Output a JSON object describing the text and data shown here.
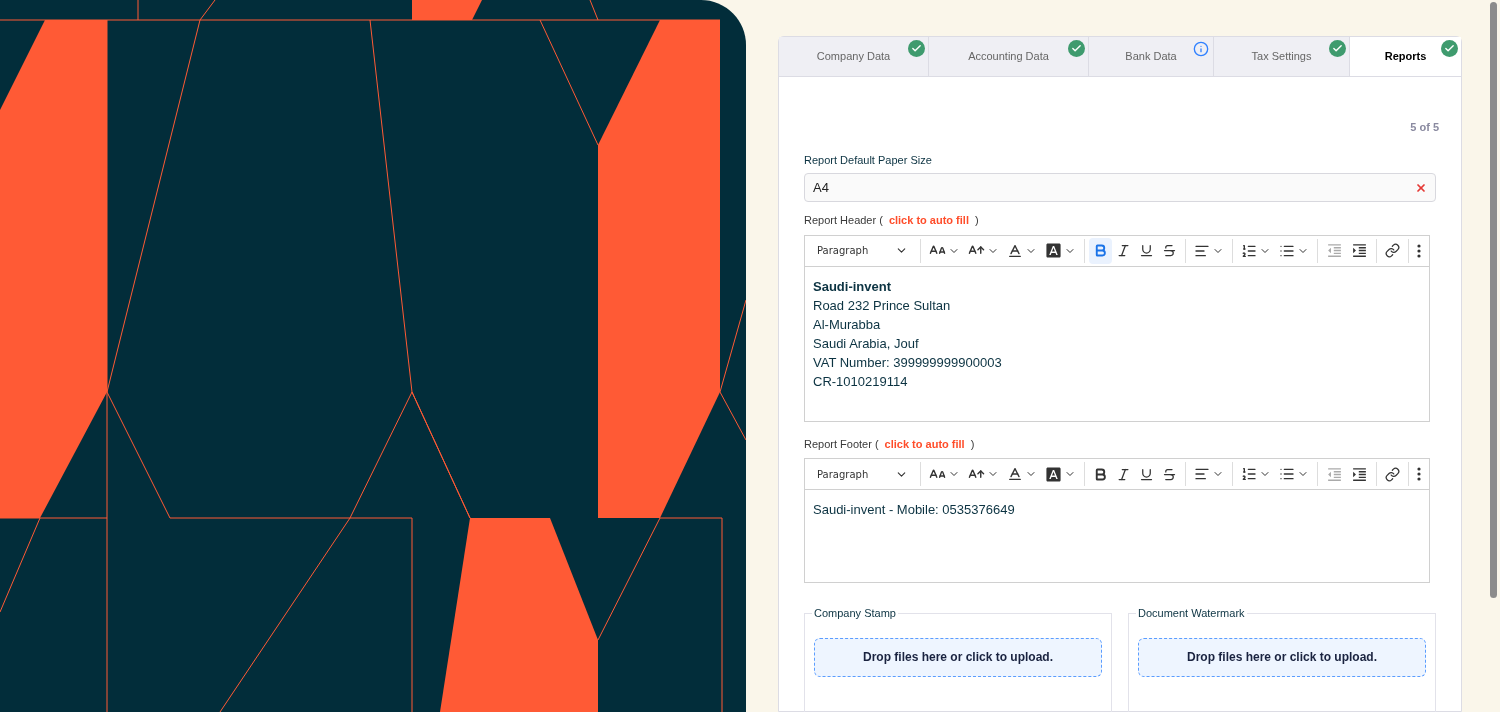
{
  "tabs": [
    {
      "label": "Company Data",
      "selected": false,
      "complete": true
    },
    {
      "label": "Accounting Data",
      "selected": false,
      "complete": true
    },
    {
      "label": "Bank Data",
      "selected": false,
      "complete": false
    },
    {
      "label": "Tax Settings",
      "selected": false,
      "complete": true
    },
    {
      "label": "Reports",
      "selected": true,
      "complete": true
    }
  ],
  "step": "5 of 5",
  "paper_size": {
    "label": "Report Default Paper Size",
    "value": "A4"
  },
  "editors": [
    {
      "label": "Report Header (",
      "autofill": "click to auto fill",
      "label_end": ")",
      "block_style": "Paragraph",
      "bold_active": true,
      "lines": [
        {
          "text": "Saudi-invent",
          "bold": true
        },
        {
          "text": "Road 232 Prince Sultan",
          "bold": false
        },
        {
          "text": "Al-Murabba",
          "bold": false
        },
        {
          "text": "Saudi Arabia, Jouf",
          "bold": false
        },
        {
          "text": "VAT Number: 399999999900003",
          "bold": false
        },
        {
          "text": "CR-1010219114",
          "bold": false
        }
      ]
    },
    {
      "label": "Report Footer (",
      "autofill": "click to auto fill",
      "label_end": ")",
      "block_style": "Paragraph",
      "bold_active": false,
      "lines": [
        {
          "text": "Saudi-invent - Mobile: 0535376649",
          "bold": false
        }
      ]
    }
  ],
  "uploads": [
    {
      "legend": "Company Stamp",
      "drop_text": "Drop files here or click to upload."
    },
    {
      "legend": "Document Watermark",
      "drop_text": "Drop files here or click to upload."
    }
  ]
}
